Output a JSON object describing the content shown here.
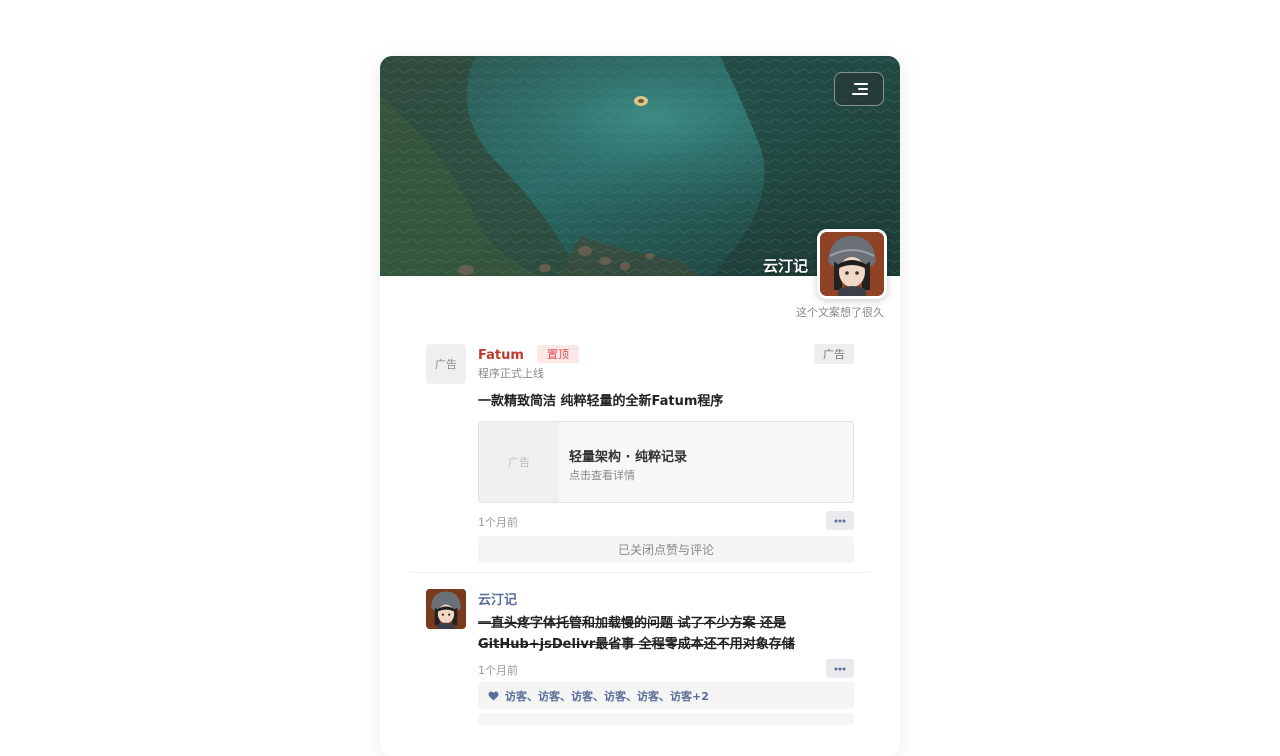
{
  "header": {
    "site_name": "云汀记",
    "tagline": "这个文案想了很久",
    "menu_icon": "menu-icon"
  },
  "posts": [
    {
      "avatar_text": "广告",
      "author": "Fatum",
      "pin_label": "置顶",
      "ad_badge": "广告",
      "subtitle": "程序正式上线",
      "content": "一款精致简洁 纯粹轻量的全新Fatum程序",
      "link_card": {
        "thumb_text": "广告",
        "title": "轻量架构 · 纯粹记录",
        "subtitle": "点击查看详情"
      },
      "time": "1个月前",
      "closed_text": "已关闭点赞与评论"
    },
    {
      "author": "云汀记",
      "content_line1": "一直头疼字体托管和加载慢的问题 试了不少方案 还是",
      "content_line2": "GitHub+jsDelivr最省事 全程零成本还不用对象存储",
      "time": "1个月前",
      "likes": "访客、访客、访客、访客、访客、访客+2"
    }
  ],
  "colors": {
    "author_ad": "#c0392b",
    "author_user": "#5a6e9a",
    "pin_bg": "#fde8e8"
  }
}
